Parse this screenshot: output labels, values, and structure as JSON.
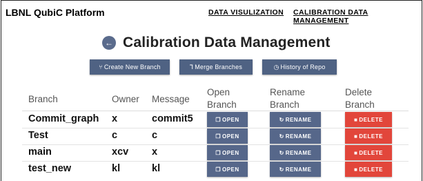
{
  "header": {
    "brand": "LBNL QubiC Platform",
    "nav": [
      {
        "label": "DATA VISULIZATION"
      },
      {
        "label": "CALIBRATION DATA MANAGEMENT"
      }
    ]
  },
  "page": {
    "title": "Calibration Data Management",
    "back_icon": "←"
  },
  "toolbar": {
    "create_icon": "⑂",
    "create_label": "Create New Branch",
    "merge_icon": "⅂",
    "merge_label": "Merge Branches",
    "history_icon": "◷",
    "history_label": "History of Repo"
  },
  "table": {
    "headers": {
      "branch": "Branch",
      "owner": "Owner",
      "message": "Message",
      "open_1": "Open",
      "open_2": "Branch",
      "rename_1": "Rename",
      "rename_2": "Branch",
      "delete_1": "Delete",
      "delete_2": "Branch"
    },
    "rows": [
      {
        "branch": "Commit_graph",
        "owner": "x",
        "message": "commit5"
      },
      {
        "branch": "Test",
        "owner": "c",
        "message": "c"
      },
      {
        "branch": "main",
        "owner": "xcv",
        "message": "x"
      },
      {
        "branch": "test_new",
        "owner": "kl",
        "message": "kl"
      }
    ],
    "actions": {
      "open_icon": "❐",
      "open_label": "OPEN",
      "rename_icon": "↻",
      "rename_label": "RENAME",
      "delete_icon": "■",
      "delete_label": "DELETE"
    }
  },
  "colors": {
    "primary_button": "#56678a",
    "delete_button": "#e2463b"
  }
}
